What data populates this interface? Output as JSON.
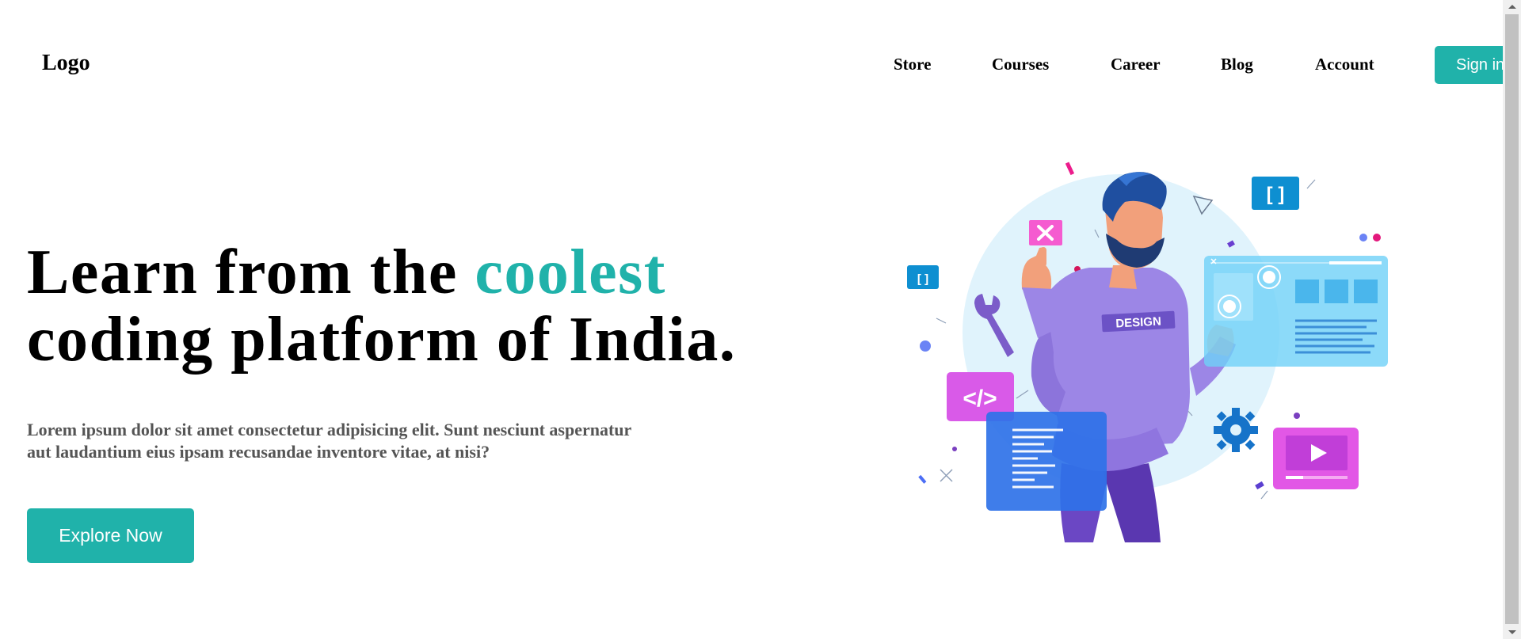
{
  "header": {
    "logo": "Logo",
    "nav": [
      "Store",
      "Courses",
      "Career",
      "Blog",
      "Account"
    ],
    "signin_label": "Sign in"
  },
  "hero": {
    "title_line1_start": "Learn from the ",
    "title_accent": "coolest",
    "title_line2": "coding platform of India.",
    "description": "Lorem ipsum dolor sit amet consectetur adipisicing elit. Sunt nesciunt aspernatur aut laudantium eius ipsam recusandae inventore vitae, at nisi?",
    "cta_label": "Explore Now"
  },
  "illustration": {
    "shirt_text": "DESIGN",
    "bracket_text": "[ ]",
    "code_text": "</>"
  },
  "colors": {
    "accent": "#20b2aa",
    "text": "#000000",
    "muted_text": "#555555"
  }
}
